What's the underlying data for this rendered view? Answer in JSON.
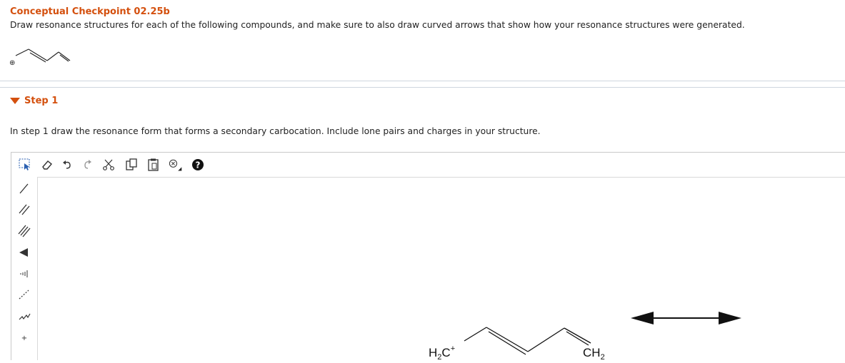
{
  "question": {
    "title": "Conceptual Checkpoint 02.25b",
    "instruction": "Draw resonance structures for each of the following compounds, and make sure to also draw curved arrows that show how your resonance structures were generated.",
    "molecule_charge": "⊕"
  },
  "step": {
    "label": "Step 1",
    "instruction": "In step 1 draw the resonance form that forms a secondary carbocation. Include lone pairs and charges in your structure."
  },
  "toolbar": {
    "icons": [
      "selection-icon",
      "eraser-icon",
      "undo-icon",
      "redo-icon",
      "cut-icon",
      "copy-icon",
      "paste-icon",
      "clear-icon",
      "help-icon"
    ],
    "help_glyph": "?"
  },
  "sidebar": {
    "icons": [
      "single-bond-icon",
      "double-bond-icon",
      "triple-bond-icon",
      "wedge-bond-icon",
      "hash-bond-icon",
      "dashed-bond-icon",
      "chain-icon",
      "charge-icon"
    ],
    "charge_glyph": "+"
  },
  "canvas": {
    "left_group": "H",
    "left_sub": "2",
    "left_atom": "C",
    "left_charge": "+",
    "right_group": "CH",
    "right_sub": "2",
    "resonance_arrow": "resonance-double-arrow"
  },
  "colors": {
    "accent": "#d4500e",
    "border": "#cfd6df",
    "icon": "#333333"
  }
}
